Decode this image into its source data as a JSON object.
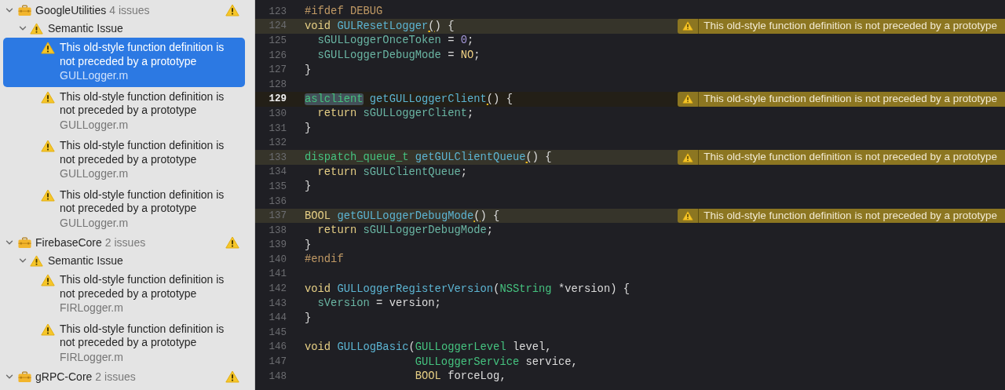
{
  "issue_navigator": {
    "groups": [
      {
        "name": "GoogleUtilities",
        "count": "4 issues",
        "expanded": true,
        "categories": [
          {
            "name": "Semantic Issue",
            "expanded": true,
            "issues": [
              {
                "message": "This old-style function definition is not preceded by a prototype",
                "file": "GULLogger.m",
                "selected": true
              },
              {
                "message": "This old-style function definition is not preceded by a prototype",
                "file": "GULLogger.m",
                "selected": false
              },
              {
                "message": "This old-style function definition is not preceded by a prototype",
                "file": "GULLogger.m",
                "selected": false
              },
              {
                "message": "This old-style function definition is not preceded by a prototype",
                "file": "GULLogger.m",
                "selected": false
              }
            ]
          }
        ]
      },
      {
        "name": "FirebaseCore",
        "count": "2 issues",
        "expanded": true,
        "categories": [
          {
            "name": "Semantic Issue",
            "expanded": true,
            "issues": [
              {
                "message": "This old-style function definition is not preceded by a prototype",
                "file": "FIRLogger.m",
                "selected": false
              },
              {
                "message": "This old-style function definition is not preceded by a prototype",
                "file": "FIRLogger.m",
                "selected": false
              }
            ]
          }
        ]
      },
      {
        "name": "gRPC-Core",
        "count": "2 issues",
        "expanded": true
      }
    ]
  },
  "editor": {
    "lines": [
      {
        "number": "123",
        "current": false,
        "tokens": [
          {
            "kind": "pre",
            "text": "#ifdef DEBUG"
          }
        ]
      },
      {
        "number": "124",
        "current": false,
        "issue": "This old-style function definition is not preceded by a prototype",
        "tokens": [
          {
            "kind": "kw",
            "text": "void "
          },
          {
            "kind": "fn",
            "text": "GULResetLogger"
          },
          {
            "kind": "fixit",
            "text": "("
          },
          {
            "kind": "plain",
            "text": ") {"
          }
        ]
      },
      {
        "number": "125",
        "current": false,
        "tokens": [
          {
            "kind": "var",
            "text": "  sGULLoggerOnceToken"
          },
          {
            "kind": "plain",
            "text": " = "
          },
          {
            "kind": "num",
            "text": "0"
          },
          {
            "kind": "plain",
            "text": ";"
          }
        ]
      },
      {
        "number": "126",
        "current": false,
        "tokens": [
          {
            "kind": "var",
            "text": "  sGULLoggerDebugMode"
          },
          {
            "kind": "plain",
            "text": " = "
          },
          {
            "kind": "const",
            "text": "NO"
          },
          {
            "kind": "plain",
            "text": ";"
          }
        ]
      },
      {
        "number": "127",
        "current": false,
        "tokens": [
          {
            "kind": "plain",
            "text": "}"
          }
        ]
      },
      {
        "number": "128",
        "current": false
      },
      {
        "number": "129",
        "current": true,
        "issue": "This old-style function definition is not preceded by a prototype",
        "tokens": [
          {
            "kind": "type-selected",
            "text": "aslclient"
          },
          {
            "kind": "fn",
            "text": " getGULLoggerClient"
          },
          {
            "kind": "fixit",
            "text": "("
          },
          {
            "kind": "plain",
            "text": ") {"
          }
        ]
      },
      {
        "number": "130",
        "current": false,
        "tokens": [
          {
            "kind": "kw",
            "text": "  return "
          },
          {
            "kind": "var",
            "text": "sGULLoggerClient"
          },
          {
            "kind": "plain",
            "text": ";"
          }
        ]
      },
      {
        "number": "131",
        "current": false,
        "tokens": [
          {
            "kind": "plain",
            "text": "}"
          }
        ]
      },
      {
        "number": "132",
        "current": false
      },
      {
        "number": "133",
        "current": false,
        "issue": "This old-style function definition is not preceded by a prototype",
        "tokens": [
          {
            "kind": "type",
            "text": "dispatch_queue_t "
          },
          {
            "kind": "fn",
            "text": "getGULClientQueue"
          },
          {
            "kind": "fixit",
            "text": "("
          },
          {
            "kind": "plain",
            "text": ") {"
          }
        ]
      },
      {
        "number": "134",
        "current": false,
        "tokens": [
          {
            "kind": "kw",
            "text": "  return "
          },
          {
            "kind": "var",
            "text": "sGULClientQueue"
          },
          {
            "kind": "plain",
            "text": ";"
          }
        ]
      },
      {
        "number": "135",
        "current": false,
        "tokens": [
          {
            "kind": "plain",
            "text": "}"
          }
        ]
      },
      {
        "number": "136",
        "current": false
      },
      {
        "number": "137",
        "current": false,
        "issue": "This old-style function definition is not preceded by a prototype",
        "tokens": [
          {
            "kind": "kw",
            "text": "BOOL "
          },
          {
            "kind": "fn",
            "text": "getGULLoggerDebugMode"
          },
          {
            "kind": "fixit",
            "text": "("
          },
          {
            "kind": "plain",
            "text": ") {"
          }
        ]
      },
      {
        "number": "138",
        "current": false,
        "tokens": [
          {
            "kind": "kw",
            "text": "  return "
          },
          {
            "kind": "var",
            "text": "sGULLoggerDebugMode"
          },
          {
            "kind": "plain",
            "text": ";"
          }
        ]
      },
      {
        "number": "139",
        "current": false,
        "tokens": [
          {
            "kind": "plain",
            "text": "}"
          }
        ]
      },
      {
        "number": "140",
        "current": false,
        "tokens": [
          {
            "kind": "pre",
            "text": "#endif"
          }
        ]
      },
      {
        "number": "141",
        "current": false
      },
      {
        "number": "142",
        "current": false,
        "tokens": [
          {
            "kind": "kw",
            "text": "void "
          },
          {
            "kind": "fn",
            "text": "GULLoggerRegisterVersion"
          },
          {
            "kind": "plain",
            "text": "("
          },
          {
            "kind": "type",
            "text": "NSString"
          },
          {
            "kind": "plain",
            "text": " *version) {"
          }
        ]
      },
      {
        "number": "143",
        "current": false,
        "tokens": [
          {
            "kind": "var",
            "text": "  sVersion"
          },
          {
            "kind": "plain",
            "text": " = version;"
          }
        ]
      },
      {
        "number": "144",
        "current": false,
        "tokens": [
          {
            "kind": "plain",
            "text": "}"
          }
        ]
      },
      {
        "number": "145",
        "current": false
      },
      {
        "number": "146",
        "current": false,
        "tokens": [
          {
            "kind": "kw",
            "text": "void "
          },
          {
            "kind": "fn",
            "text": "GULLogBasic"
          },
          {
            "kind": "plain",
            "text": "("
          },
          {
            "kind": "type",
            "text": "GULLoggerLevel"
          },
          {
            "kind": "plain",
            "text": " level,"
          }
        ]
      },
      {
        "number": "147",
        "current": false,
        "tokens": [
          {
            "kind": "type",
            "text": "                 GULLoggerService"
          },
          {
            "kind": "plain",
            "text": " service,"
          }
        ]
      },
      {
        "number": "148",
        "current": false,
        "tokens": [
          {
            "kind": "kw",
            "text": "                 BOOL"
          },
          {
            "kind": "plain",
            "text": " forceLog,"
          }
        ]
      }
    ]
  }
}
